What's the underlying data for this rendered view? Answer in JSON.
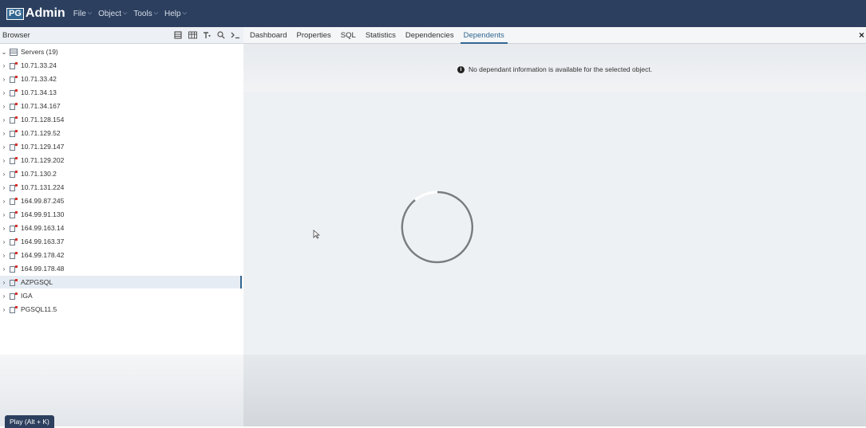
{
  "app": {
    "logo_pg": "PG",
    "logo_admin": "Admin",
    "menus": [
      {
        "label": "File"
      },
      {
        "label": "Object"
      },
      {
        "label": "Tools"
      },
      {
        "label": "Help"
      }
    ]
  },
  "browser": {
    "title": "Browser",
    "tree": {
      "root": "Servers (19)",
      "servers": [
        "10.71.33.24",
        "10.71.33.42",
        "10.71.34.13",
        "10.71.34.167",
        "10.71.128.154",
        "10.71.129.52",
        "10.71.129.147",
        "10.71.129.202",
        "10.71.130.2",
        "10.71.131.224",
        "164.99.87.245",
        "164.99.91.130",
        "164.99.163.14",
        "164.99.163.37",
        "164.99.178.42",
        "164.99.178.48",
        "AZPGSQL",
        "IGA",
        "PGSQL11.5"
      ],
      "selected": "AZPGSQL"
    }
  },
  "tabs": [
    {
      "label": "Dashboard"
    },
    {
      "label": "Properties"
    },
    {
      "label": "SQL"
    },
    {
      "label": "Statistics"
    },
    {
      "label": "Dependencies"
    },
    {
      "label": "Dependents",
      "active": true
    }
  ],
  "content": {
    "message": "No dependant information is available for the selected object."
  },
  "footer": {
    "play_label": "Play (Alt + K)"
  },
  "colors": {
    "navbar": "#2c3f5e",
    "accent": "#326690",
    "server_badge": "#d9322b"
  }
}
